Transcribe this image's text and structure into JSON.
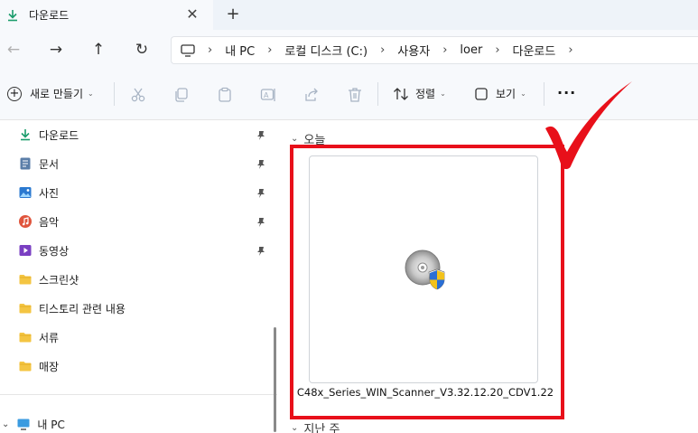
{
  "tab": {
    "title": "다운로드",
    "close_symbol": "✕",
    "new_tab_symbol": "+"
  },
  "nav": {
    "back": "←",
    "forward": "→",
    "up": "↑",
    "refresh": "↻"
  },
  "address": {
    "crumbs": [
      "내 PC",
      "로컬 디스크 (C:)",
      "사용자",
      "loer",
      "다운로드"
    ],
    "separator": "›"
  },
  "toolbar": {
    "new_label": "새로 만들기",
    "sort_label": "정렬",
    "view_label": "보기",
    "more_label": "···",
    "icons": [
      "cut-icon",
      "copy-icon",
      "paste-icon",
      "rename-icon",
      "share-icon",
      "delete-icon"
    ]
  },
  "sidebar": {
    "quick_access": [
      {
        "label": "다운로드",
        "icon": "download-icon",
        "pinned": true
      },
      {
        "label": "문서",
        "icon": "document-icon",
        "pinned": true
      },
      {
        "label": "사진",
        "icon": "pictures-icon",
        "pinned": true
      },
      {
        "label": "음악",
        "icon": "music-icon",
        "pinned": true
      },
      {
        "label": "동영상",
        "icon": "video-icon",
        "pinned": true
      },
      {
        "label": "스크린샷",
        "icon": "folder-icon",
        "pinned": false
      },
      {
        "label": "티스토리 관련 내용",
        "icon": "folder-icon",
        "pinned": false
      },
      {
        "label": "서류",
        "icon": "folder-icon",
        "pinned": false
      },
      {
        "label": "매장",
        "icon": "folder-icon",
        "pinned": false
      }
    ],
    "this_pc": {
      "label": "내 PC",
      "icon": "pc-icon"
    }
  },
  "main": {
    "groups": [
      {
        "label": "오늘"
      },
      {
        "label": "지난 주"
      }
    ],
    "file": {
      "name": "C48x_Series_WIN_Scanner_V3.32.12.20_CDV1.22",
      "icon": "disc-setup-icon"
    }
  },
  "colors": {
    "highlight": "#e8101a",
    "accent": "#1a9c6b",
    "folder": "#f4c542"
  }
}
